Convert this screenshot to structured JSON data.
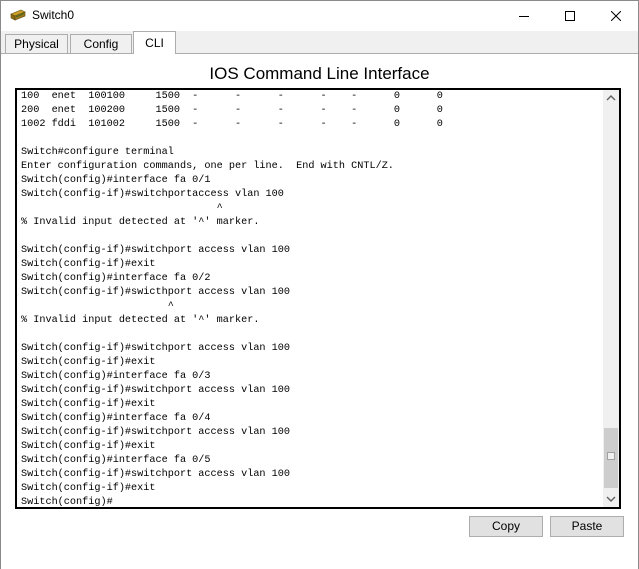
{
  "window": {
    "title": "Switch0",
    "controls": {
      "minimize": "—",
      "maximize": "☐",
      "close": "✕"
    }
  },
  "tabs": [
    {
      "label": "Physical",
      "active": false
    },
    {
      "label": "Config",
      "active": false
    },
    {
      "label": "CLI",
      "active": true
    }
  ],
  "cli": {
    "heading": "IOS Command Line Interface",
    "lines": [
      "100  enet  100100     1500  -      -      -      -    -      0      0",
      "200  enet  100200     1500  -      -      -      -    -      0      0",
      "1002 fddi  101002     1500  -      -      -      -    -      0      0",
      "",
      "Switch#configure terminal",
      "Enter configuration commands, one per line.  End with CNTL/Z.",
      "Switch(config)#interface fa 0/1",
      "Switch(config-if)#switchportaccess vlan 100",
      "                                ^",
      "% Invalid input detected at '^' marker.",
      "",
      "Switch(config-if)#switchport access vlan 100",
      "Switch(config-if)#exit",
      "Switch(config)#interface fa 0/2",
      "Switch(config-if)#swicthport access vlan 100",
      "                        ^",
      "% Invalid input detected at '^' marker.",
      "",
      "Switch(config-if)#switchport access vlan 100",
      "Switch(config-if)#exit",
      "Switch(config)#interface fa 0/3",
      "Switch(config-if)#switchport access vlan 100",
      "Switch(config-if)#exit",
      "Switch(config)#interface fa 0/4",
      "Switch(config-if)#switchport access vlan 100",
      "Switch(config-if)#exit",
      "Switch(config)#interface fa 0/5",
      "Switch(config-if)#switchport access vlan 100",
      "Switch(config-if)#exit",
      "Switch(config)#"
    ]
  },
  "buttons": {
    "copy": "Copy",
    "paste": "Paste"
  },
  "icons": {
    "app": "switch-icon",
    "scroll_up": "arrow-up-icon",
    "scroll_down": "arrow-down-icon"
  },
  "colors": {
    "background": "#f0f0f0",
    "panel": "#ffffff",
    "border": "#adadad",
    "terminal_border": "#000000"
  }
}
